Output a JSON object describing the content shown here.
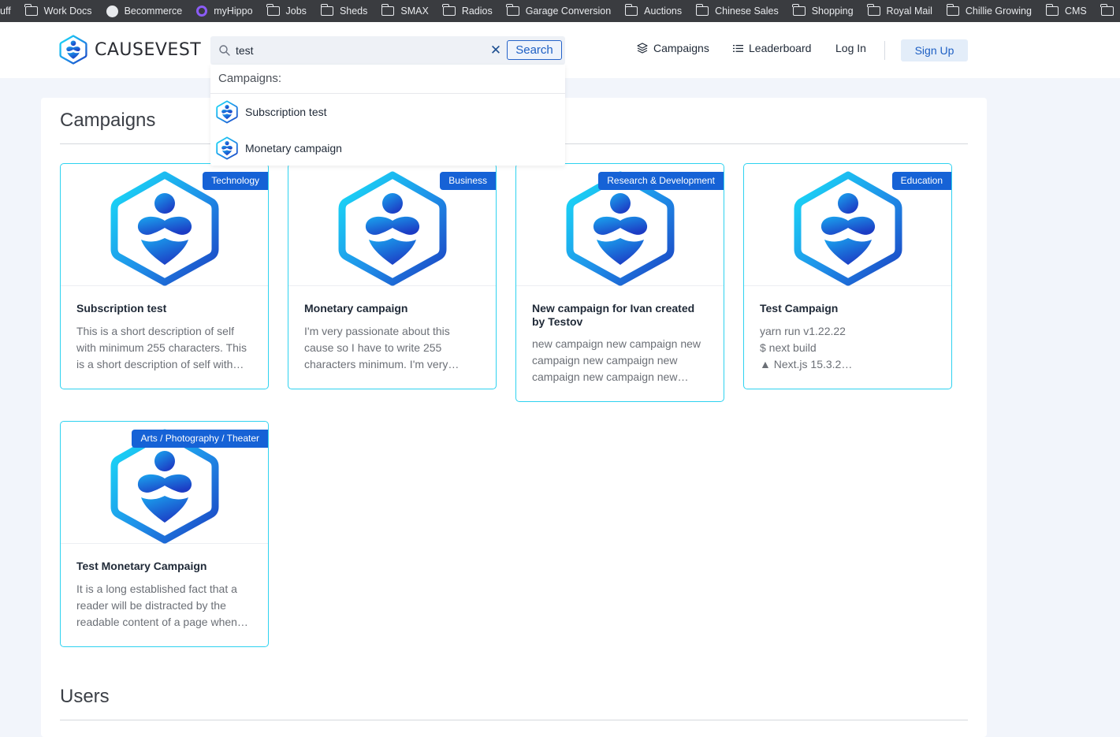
{
  "bookmarks": [
    {
      "label": "uff",
      "icon": "none"
    },
    {
      "label": "Work Docs",
      "icon": "folder-icon"
    },
    {
      "label": "Becommerce",
      "icon": "github-icon"
    },
    {
      "label": "myHippo",
      "icon": "hippo-icon"
    },
    {
      "label": "Jobs",
      "icon": "folder-icon"
    },
    {
      "label": "Sheds",
      "icon": "folder-icon"
    },
    {
      "label": "SMAX",
      "icon": "folder-icon"
    },
    {
      "label": "Radios",
      "icon": "folder-icon"
    },
    {
      "label": "Garage Conversion",
      "icon": "folder-icon"
    },
    {
      "label": "Auctions",
      "icon": "folder-icon"
    },
    {
      "label": "Chinese Sales",
      "icon": "folder-icon"
    },
    {
      "label": "Shopping",
      "icon": "folder-icon"
    },
    {
      "label": "Royal Mail",
      "icon": "folder-icon"
    },
    {
      "label": "Chillie Growing",
      "icon": "folder-icon"
    },
    {
      "label": "CMS",
      "icon": "folder-icon"
    },
    {
      "label": "",
      "icon": "folder-icon"
    }
  ],
  "header": {
    "brand": "CAUSEVEST",
    "search": {
      "value": "test",
      "clear_symbol": "✕",
      "button_label": "Search"
    },
    "nav": {
      "campaigns": "Campaigns",
      "leaderboard": "Leaderboard",
      "login": "Log In",
      "signup": "Sign Up"
    }
  },
  "dropdown": {
    "header": "Campaigns:",
    "items": [
      "Subscription test",
      "Monetary campaign"
    ]
  },
  "sections": {
    "campaigns_title": "Campaigns",
    "users_title": "Users"
  },
  "campaigns": [
    {
      "category": "Technology",
      "title": "Subscription test",
      "description": "This is a short description of self with minimum 255 characters. This is a short description of self with…"
    },
    {
      "category": "Business",
      "title": "Monetary campaign",
      "description": "I'm very passionate about this cause so I have to write 255 characters minimum. I'm very…"
    },
    {
      "category": "Research & Development",
      "title": "New campaign for Ivan created by Testov",
      "description": "new campaign new campaign new campaign new campaign new campaign new campaign new…"
    },
    {
      "category": "Education",
      "title": "Test Campaign",
      "description_lines": [
        "yarn run v1.22.22",
        "$ next build",
        "▲ Next.js 15.3.2…"
      ]
    },
    {
      "category": "Arts / Photography / Theater",
      "title": "Test Monetary Campaign",
      "description": "It is a long established fact that a reader will be distracted by the readable content of a page when…"
    }
  ],
  "colors": {
    "accent": "#1662d6",
    "card_border": "#2ed2f0",
    "logo_gradient_start": "#19d3f5",
    "logo_gradient_end": "#1b3fc1"
  }
}
